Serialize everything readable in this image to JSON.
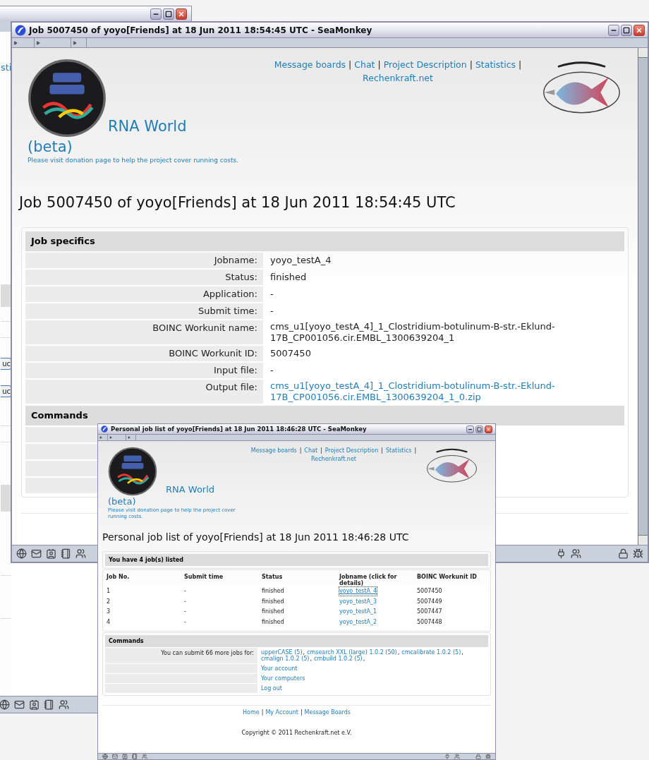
{
  "back_window": {
    "fragments": [
      {
        "kind": "link",
        "text": "sti"
      },
      {
        "kind": "button",
        "text": "uc"
      },
      {
        "kind": "button",
        "text": "uc"
      }
    ]
  },
  "main_window": {
    "title": "Job 5007450 of yoyo[Friends] at 18 Jun 2011 18:54:45 UTC - SeaMonkey",
    "nav_links": [
      "Message boards",
      "Chat",
      "Project Description",
      "Statistics",
      "Rechenkraft.net"
    ],
    "nav_separator": "|",
    "site_title": "RNA World",
    "site_subtitle": "(beta)",
    "donation_note": "Please visit donation page to help the project cover running costs.",
    "heading": "Job 5007450 of yoyo[Friends] at 18 Jun 2011 18:54:45 UTC",
    "job_specifics": {
      "title": "Job specifics",
      "rows": [
        {
          "label": "Jobname:",
          "value": "yoyo_testA_4",
          "kind": "text"
        },
        {
          "label": "Status:",
          "value": "finished",
          "kind": "text"
        },
        {
          "label": "Application:",
          "value": "-",
          "kind": "text"
        },
        {
          "label": "Submit time:",
          "value": "-",
          "kind": "text"
        },
        {
          "label": "BOINC Workunit name:",
          "value": "cms_u1[yoyo_testA_4]_1_Clostridium-botulinum-B-str.-Eklund-17B_CP001056.cir.EMBL_1300639204_1",
          "kind": "text"
        },
        {
          "label": "BOINC Workunit ID:",
          "value": "5007450",
          "kind": "text"
        },
        {
          "label": "Input file:",
          "value": "-",
          "kind": "text"
        },
        {
          "label": "Output file:",
          "value": "cms_u1[yoyo_testA_4]_1_Clostridium-botulinum-B-str.-Eklund-17B_CP001056.cir.EMBL_1300639204_1_0.zip",
          "kind": "link"
        }
      ]
    },
    "commands": {
      "title": "Commands"
    }
  },
  "job_list_window": {
    "title": "Personal job list of yoyo[Friends] at 18 Jun 2011 18:46:28 UTC - SeaMonkey",
    "nav_links": [
      "Message boards",
      "Chat",
      "Project Description",
      "Statistics",
      "Rechenkraft.net"
    ],
    "nav_separator": "|",
    "site_title": "RNA World",
    "site_subtitle": "(beta)",
    "donation_note": "Please visit donation page to help the project cover running costs.",
    "heading": "Personal job list of yoyo[Friends] at 18 Jun 2011 18:46:28 UTC",
    "summary": "You have 4 job(s) listed",
    "table": {
      "columns": [
        "Job No.",
        "Submit time",
        "Status",
        "Jobname (click for details)",
        "BOINC Workunit ID"
      ],
      "rows": [
        {
          "job_no": "1",
          "submit_time": "-",
          "status": "finished",
          "jobname": "yoyo_testA_4",
          "workunit_id": "5007450",
          "focused": true
        },
        {
          "job_no": "2",
          "submit_time": "-",
          "status": "finished",
          "jobname": "yoyo_testA_3",
          "workunit_id": "5007449",
          "focused": false
        },
        {
          "job_no": "3",
          "submit_time": "-",
          "status": "finished",
          "jobname": "yoyo_testA_1",
          "workunit_id": "5007447",
          "focused": false
        },
        {
          "job_no": "4",
          "submit_time": "-",
          "status": "finished",
          "jobname": "yoyo_testA_2",
          "workunit_id": "5007448",
          "focused": false
        }
      ]
    },
    "commands": {
      "title": "Commands",
      "submit_label": "You can submit 66 more jobs for:",
      "app_separator": ",",
      "apps": [
        "upperCASE (5)",
        "cmsearch XXL (large) 1.0.2 (50)",
        "cmcalibrate 1.0.2 (5)",
        "cmalign 1.0.2 (5)",
        "cmbuild 1.0.2 (5)"
      ],
      "links": [
        "Your account",
        "Your computers",
        "Log out"
      ]
    },
    "footer_links": [
      "Home",
      "My Account",
      "Message Boards"
    ],
    "footer_separator": "|",
    "copyright": "Copyright © 2011 Rechenkraft.net e.V."
  }
}
